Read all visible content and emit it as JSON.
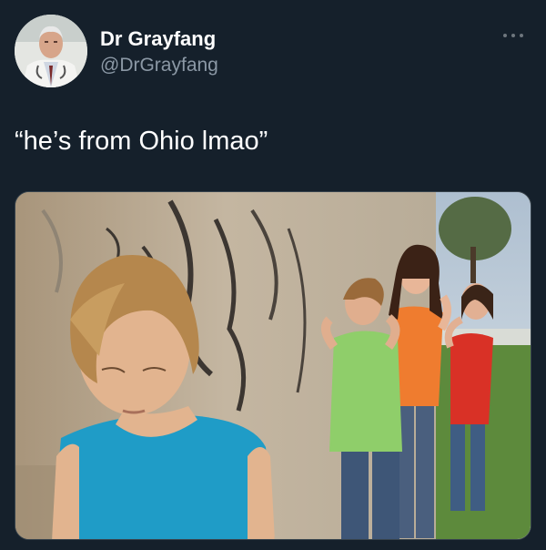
{
  "tweet": {
    "display_name": "Dr Grayfang",
    "handle": "@DrGrayfang",
    "text": "“he’s from Ohio lmao”",
    "more_icon": "more-horizontal-icon",
    "avatar_icon": "avatar-photo"
  },
  "media": {
    "kind": "photo",
    "description_icon": "photo-boy-against-graffiti-wall-with-kids-pointing"
  },
  "colors": {
    "background": "#15202b",
    "secondary_text": "#8b98a5",
    "border": "#38444d"
  }
}
